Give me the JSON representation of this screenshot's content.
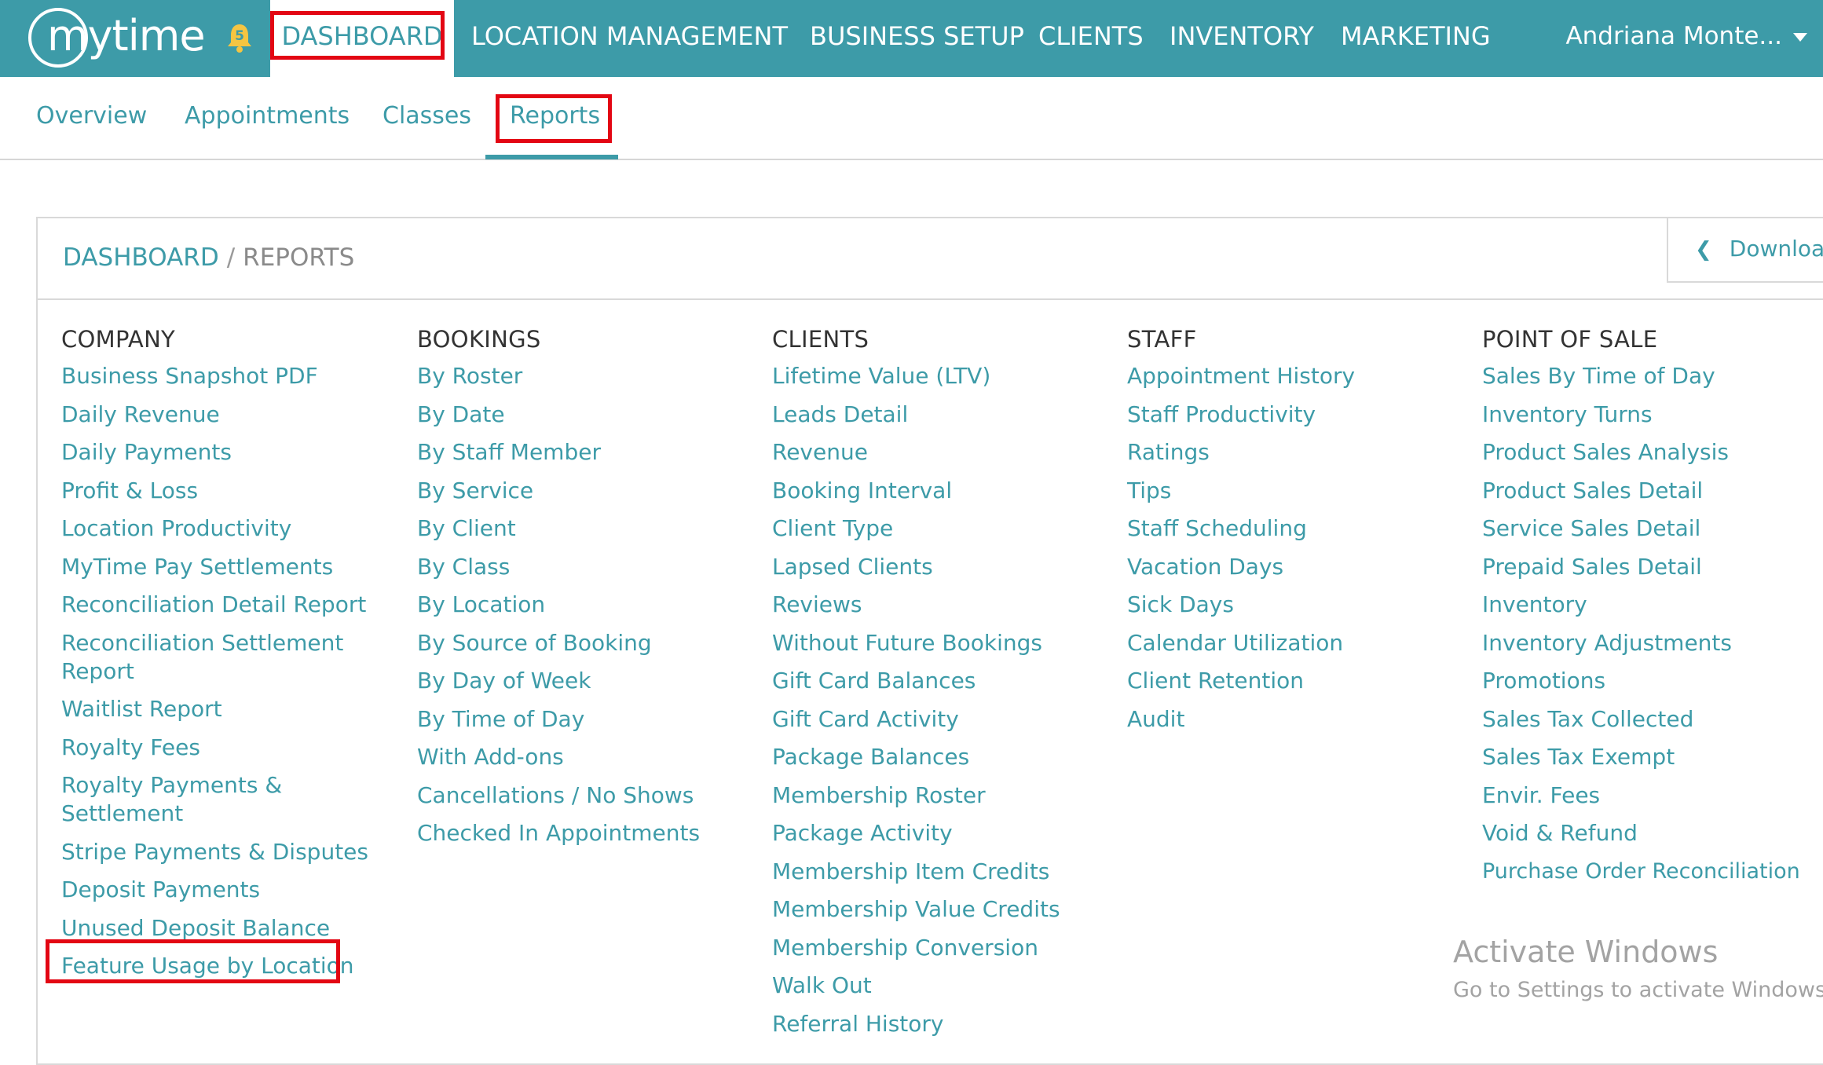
{
  "header": {
    "logo_text": "mytime",
    "notification_count": "5",
    "nav": [
      {
        "label": "DASHBOARD"
      },
      {
        "label": "LOCATION MANAGEMENT"
      },
      {
        "label": "BUSINESS SETUP"
      },
      {
        "label": "CLIENTS"
      },
      {
        "label": "INVENTORY"
      },
      {
        "label": "MARKETING"
      }
    ],
    "user_name": "Andriana Monte..."
  },
  "subtabs": [
    {
      "label": "Overview"
    },
    {
      "label": "Appointments"
    },
    {
      "label": "Classes"
    },
    {
      "label": "Reports"
    }
  ],
  "breadcrumb": {
    "root": "DASHBOARD",
    "separator": "/",
    "current": "REPORTS"
  },
  "downloads_label": "Downloads",
  "columns": [
    {
      "heading": "COMPANY",
      "items": [
        "Business Snapshot PDF",
        "Daily Revenue",
        "Daily Payments",
        "Profit & Loss",
        "Location Productivity",
        "MyTime Pay Settlements",
        "Reconciliation Detail Report",
        "Reconciliation Settlement Report",
        "Waitlist Report",
        "Royalty Fees",
        "Royalty Payments & Settlement",
        "Stripe Payments & Disputes",
        "Deposit Payments",
        "Unused Deposit Balance",
        "Feature Usage by Location"
      ]
    },
    {
      "heading": "BOOKINGS",
      "items": [
        "By Roster",
        "By Date",
        "By Staff Member",
        "By Service",
        "By Client",
        "By Class",
        "By Location",
        "By Source of Booking",
        "By Day of Week",
        "By Time of Day",
        "With Add-ons",
        "Cancellations / No Shows",
        "Checked In Appointments"
      ]
    },
    {
      "heading": "CLIENTS",
      "items": [
        "Lifetime Value (LTV)",
        "Leads Detail",
        "Revenue",
        "Booking Interval",
        "Client Type",
        "Lapsed Clients",
        "Reviews",
        "Without Future Bookings",
        "Gift Card Balances",
        "Gift Card Activity",
        "Package Balances",
        "Membership Roster",
        "Package Activity",
        "Membership Item Credits",
        "Membership Value Credits",
        "Membership Conversion",
        "Walk Out",
        "Referral History"
      ]
    },
    {
      "heading": "STAFF",
      "items": [
        "Appointment History",
        "Staff Productivity",
        "Ratings",
        "Tips",
        "Staff Scheduling",
        "Vacation Days",
        "Sick Days",
        "Calendar Utilization",
        "Client Retention",
        "Audit"
      ]
    },
    {
      "heading": "POINT OF SALE",
      "items": [
        "Sales By Time of Day",
        "Inventory Turns",
        "Product Sales Analysis",
        "Product Sales Detail",
        "Service Sales Detail",
        "Prepaid Sales Detail",
        "Inventory",
        "Inventory Adjustments",
        "Promotions",
        "Sales Tax Collected",
        "Sales Tax Exempt",
        "Envir. Fees",
        "Void & Refund",
        "Purchase Order Reconciliation"
      ]
    }
  ],
  "watermark": {
    "title": "Activate Windows",
    "subtitle": "Go to Settings to activate Windows."
  },
  "colors": {
    "brand_teal": "#3d9ba8",
    "highlight_red": "#e30613"
  }
}
